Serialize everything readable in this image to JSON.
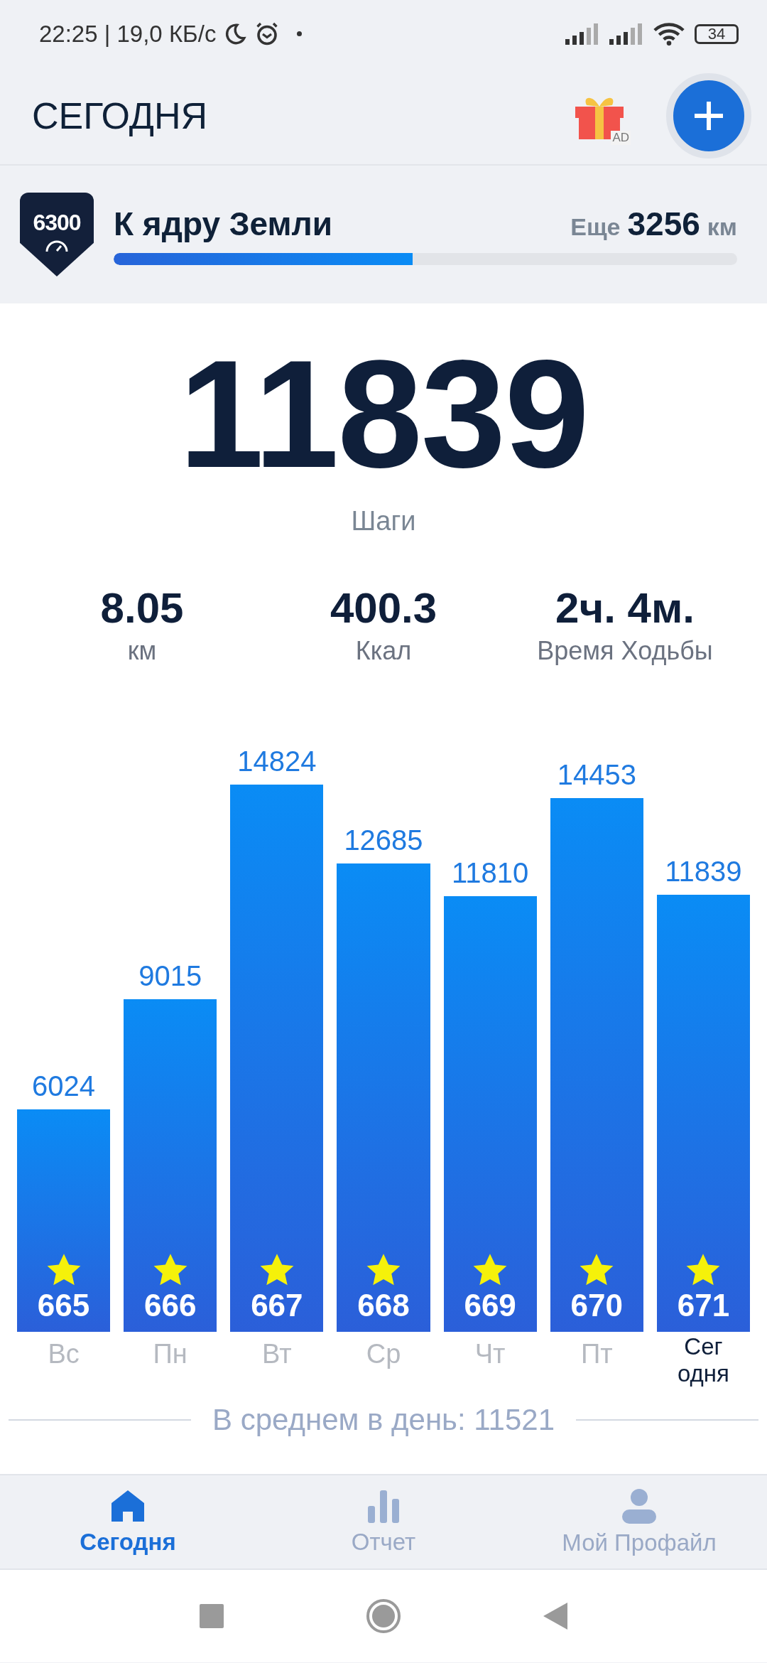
{
  "status_bar": {
    "time_and_speed": "22:25 | 19,0 КБ/с",
    "battery": "34"
  },
  "header": {
    "title": "СЕГОДНЯ",
    "ad_label": "AD"
  },
  "goal": {
    "badge": "6300",
    "title": "К ядру Земли",
    "remaining_label": "Еще",
    "remaining_value": "3256",
    "remaining_unit": "км",
    "level": 0.48
  },
  "steps": {
    "value": "11839",
    "label": "Шаги"
  },
  "stats": [
    {
      "value": "8.05",
      "label": "км"
    },
    {
      "value": "400.3",
      "label": "Ккал"
    },
    {
      "value": "2ч. 4м.",
      "label": "Время Ходьбы"
    }
  ],
  "week": {
    "chart_data": {
      "type": "bar",
      "categories": [
        "Вс",
        "Пн",
        "Вт",
        "Ср",
        "Чт",
        "Пт",
        "Сег\nодня"
      ],
      "values": [
        6024,
        9015,
        14824,
        12685,
        11810,
        14453,
        11839
      ],
      "data_labels": true
    },
    "selected": [
      false,
      false,
      false,
      false,
      false,
      false,
      true
    ],
    "badges": [
      "665",
      "666",
      "667",
      "668",
      "669",
      "670",
      "671"
    ],
    "average": "В среднем в день: 11521"
  },
  "bottom_nav": [
    {
      "label": "Сегодня",
      "selected": true,
      "kind": "home"
    },
    {
      "label": "Отчет",
      "selected": false,
      "kind": "report"
    },
    {
      "label": "Мой Профайл",
      "selected": false,
      "kind": "profile"
    }
  ]
}
